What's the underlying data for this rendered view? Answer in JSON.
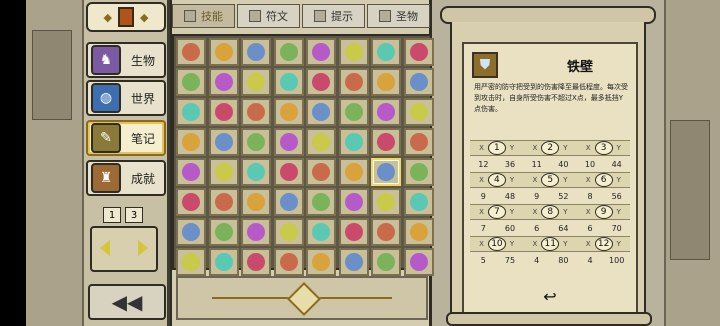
{
  "tabs": [
    {
      "label": "技能",
      "icon": "skill-icon",
      "active": true
    },
    {
      "label": "符文",
      "icon": "rune-icon",
      "active": false
    },
    {
      "label": "提示",
      "icon": "hint-icon",
      "active": false
    },
    {
      "label": "圣物",
      "icon": "relic-icon",
      "active": false
    }
  ],
  "side": {
    "items": [
      {
        "label": "生物",
        "icon": "creature-icon"
      },
      {
        "label": "世界",
        "icon": "world-icon"
      },
      {
        "label": "笔记",
        "icon": "notes-icon"
      },
      {
        "label": "成就",
        "icon": "achievement-icon"
      }
    ],
    "pages": [
      "1",
      "3"
    ]
  },
  "detail": {
    "title": "铁壁",
    "description": "用严密的防守把受到的伤害降至最低程度。每次受到攻击时，自身所受伤害不超过X点，最多抵挡Y点伤害。",
    "levels": [
      {
        "n": "1",
        "x": "12",
        "y": "36"
      },
      {
        "n": "2",
        "x": "11",
        "y": "40"
      },
      {
        "n": "3",
        "x": "10",
        "y": "44"
      },
      {
        "n": "4",
        "x": "9",
        "y": "48"
      },
      {
        "n": "5",
        "x": "9",
        "y": "52"
      },
      {
        "n": "6",
        "x": "8",
        "y": "56"
      },
      {
        "n": "7",
        "x": "7",
        "y": "60"
      },
      {
        "n": "8",
        "x": "6",
        "y": "64"
      },
      {
        "n": "9",
        "x": "6",
        "y": "70"
      },
      {
        "n": "10",
        "x": "5",
        "y": "75"
      },
      {
        "n": "11",
        "x": "4",
        "y": "80"
      },
      {
        "n": "12",
        "x": "4",
        "y": "100"
      }
    ]
  },
  "colors": {
    "selected": "#f2d760",
    "cell": "#c9bf98"
  }
}
